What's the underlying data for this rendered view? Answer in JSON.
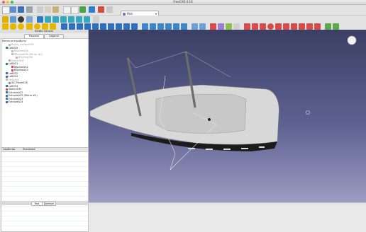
{
  "window": {
    "title": "FreeCAD 0.16"
  },
  "toolbar": {
    "workbench_selected": "Part"
  },
  "colors": {
    "viewport_top": "#3a3f64",
    "viewport_bottom": "#9b9cc2",
    "hull": "#d7d7d7",
    "accent_select": "#8a6bd1"
  },
  "combo_view": {
    "title": "Комбо панель",
    "tabs": [
      "Модель",
      "Задачи"
    ],
    "tree_header": "Метки и атрибуты",
    "tree_items": [
      {
        "label": "Ruled_Surface038",
        "dim": true
      },
      {
        "label": "Loft029",
        "dim": false
      },
      {
        "label": "BSpline036",
        "dim": true
      },
      {
        "label": "BSpline036 (Mirror #1)",
        "dim": true
      },
      {
        "label": "BSpline036",
        "dim": true
      },
      {
        "label": "Sketch037",
        "dim": true
      },
      {
        "label": "Loft031",
        "dim": false
      },
      {
        "label": "BSpline042",
        "dim": false
      },
      {
        "label": "BSpline043",
        "dim": false
      },
      {
        "label": "Loft032",
        "dim": false
      },
      {
        "label": "Loft033",
        "dim": false
      },
      {
        "label": "Helix001",
        "dim": true
      },
      {
        "label": "XZ_Plane026",
        "dim": false
      },
      {
        "label": "Loft034",
        "dim": false
      },
      {
        "label": "Sketch039",
        "dim": false
      },
      {
        "label": "Extrude021",
        "dim": false
      },
      {
        "label": "Extrude022 (Mirror #1)",
        "dim": false
      },
      {
        "label": "Extrude023",
        "dim": false
      },
      {
        "label": "Extrude024",
        "dim": false
      }
    ],
    "props_headers": [
      "Свойство",
      "Значение"
    ],
    "bottom_tabs": [
      "Вид",
      "Данные"
    ]
  }
}
